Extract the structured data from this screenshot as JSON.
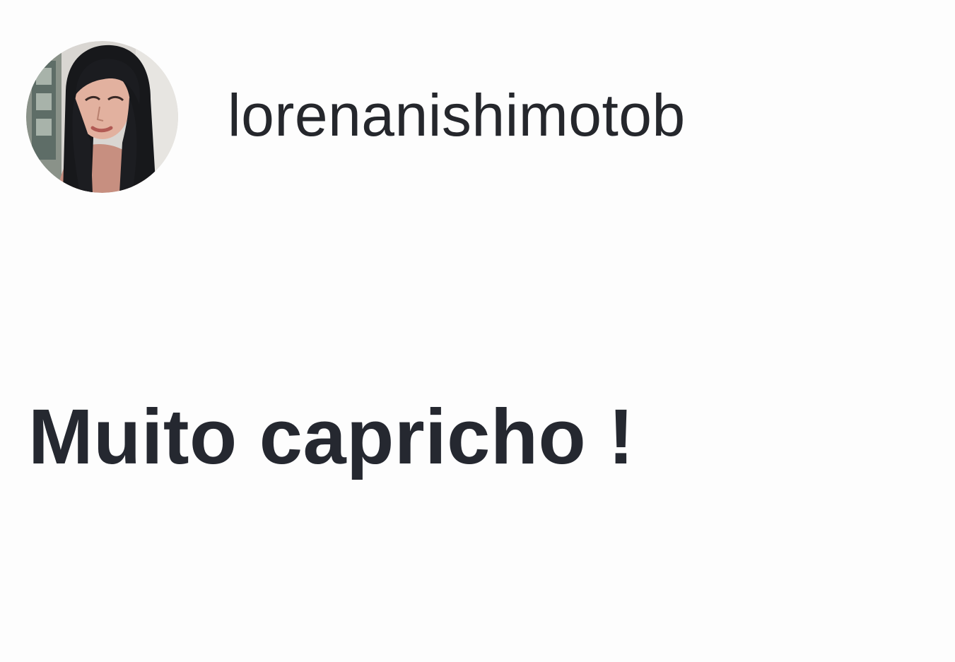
{
  "comment": {
    "author": {
      "username": "lorenanishimotob",
      "avatar_icon": "profile-photo-avatar"
    },
    "text": "Muito capricho !"
  },
  "colors": {
    "background": "#fdfdfd",
    "text": "#25272c"
  }
}
